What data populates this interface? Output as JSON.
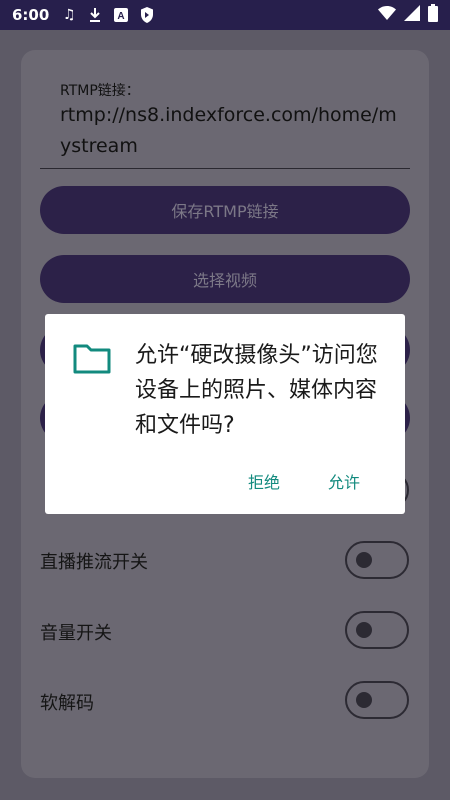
{
  "status_bar": {
    "time": "6:00",
    "icons_left": [
      "music-note-icon",
      "download-icon",
      "font-a-icon",
      "shield-icon"
    ],
    "icons_right": [
      "wifi-icon",
      "signal-icon",
      "battery-icon"
    ]
  },
  "form": {
    "rtmp_label": "RTMP链接：",
    "rtmp_value": "rtmp://ns8.indexforce.com/home/mystream",
    "save_button": "保存RTMP链接",
    "select_video_button": "选择视频"
  },
  "toggles": [
    {
      "label": "直播推流开关",
      "on": false
    },
    {
      "label": "音量开关",
      "on": false
    },
    {
      "label": "软解码",
      "on": false
    }
  ],
  "dialog": {
    "icon": "folder-icon",
    "message": "允许“硬改摄像头”访问您设备上的照片、媒体内容和文件吗?",
    "deny_label": "拒绝",
    "allow_label": "允许",
    "accent_color": "#128a7e"
  }
}
